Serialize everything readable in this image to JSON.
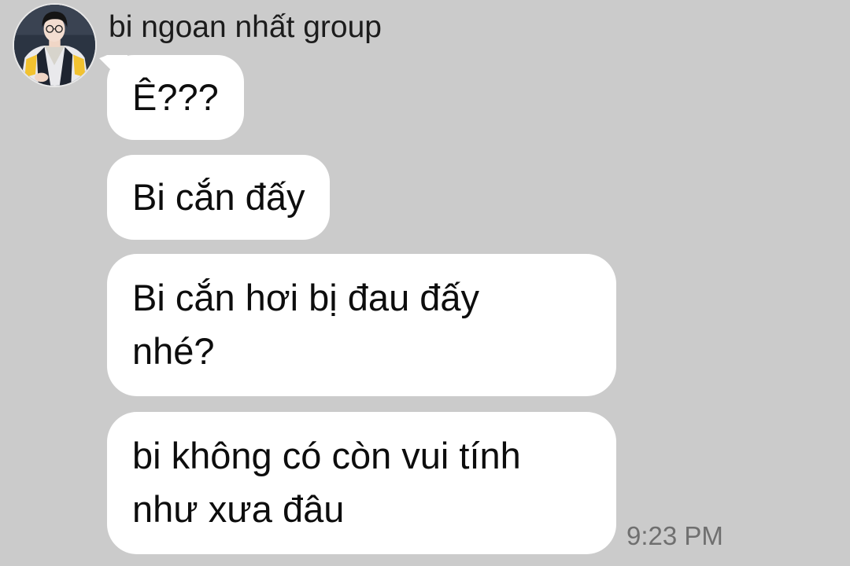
{
  "conversation": {
    "sender_name": "bi ngoan nhất group",
    "avatar_icon": "profile-photo",
    "messages": [
      {
        "lines": [
          "Ê???"
        ]
      },
      {
        "lines": [
          "Bi cắn đấy"
        ]
      },
      {
        "lines": [
          "Bi cắn hơi bị đau đấy",
          "nhé?"
        ]
      },
      {
        "lines": [
          "bi không có còn vui tính",
          "như xưa đâu"
        ]
      }
    ],
    "timestamp": "9:23 PM"
  },
  "colors": {
    "background": "#cbcbcb",
    "bubble": "#ffffff",
    "text": "#0d0d0d",
    "timestamp": "#6f6f6f"
  }
}
